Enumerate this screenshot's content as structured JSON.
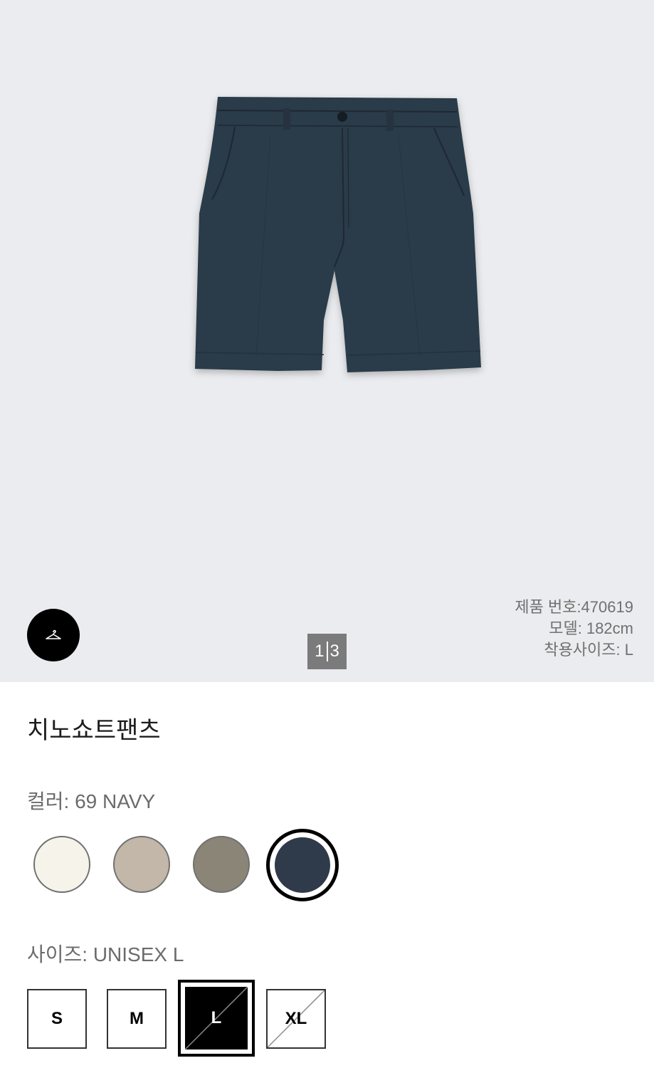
{
  "product": {
    "name": "치노쇼트팬츠",
    "number_line": "제품 번호:470619",
    "model_line": "모델: 182cm",
    "wear_size_line": "착용사이즈: L"
  },
  "gallery": {
    "current": "1",
    "total": "3",
    "hanger_icon": "hanger-icon"
  },
  "color": {
    "label": "컬러: 69 NAVY",
    "swatches": [
      {
        "name": "off-white",
        "hex": "#f6f3ea"
      },
      {
        "name": "beige",
        "hex": "#c2b7a8"
      },
      {
        "name": "olive",
        "hex": "#8a8576"
      },
      {
        "name": "navy",
        "hex": "#2f3b4a",
        "selected": true
      }
    ]
  },
  "size": {
    "label": "사이즈: UNISEX L",
    "options": [
      {
        "label": "S",
        "available": true
      },
      {
        "label": "M",
        "available": true
      },
      {
        "label": "L",
        "available": false,
        "selected": true
      },
      {
        "label": "XL",
        "available": false
      }
    ]
  },
  "colors": {
    "background": "#ebecef",
    "shorts": "#2c3a48",
    "counter_bg": "#7b7b7b"
  }
}
